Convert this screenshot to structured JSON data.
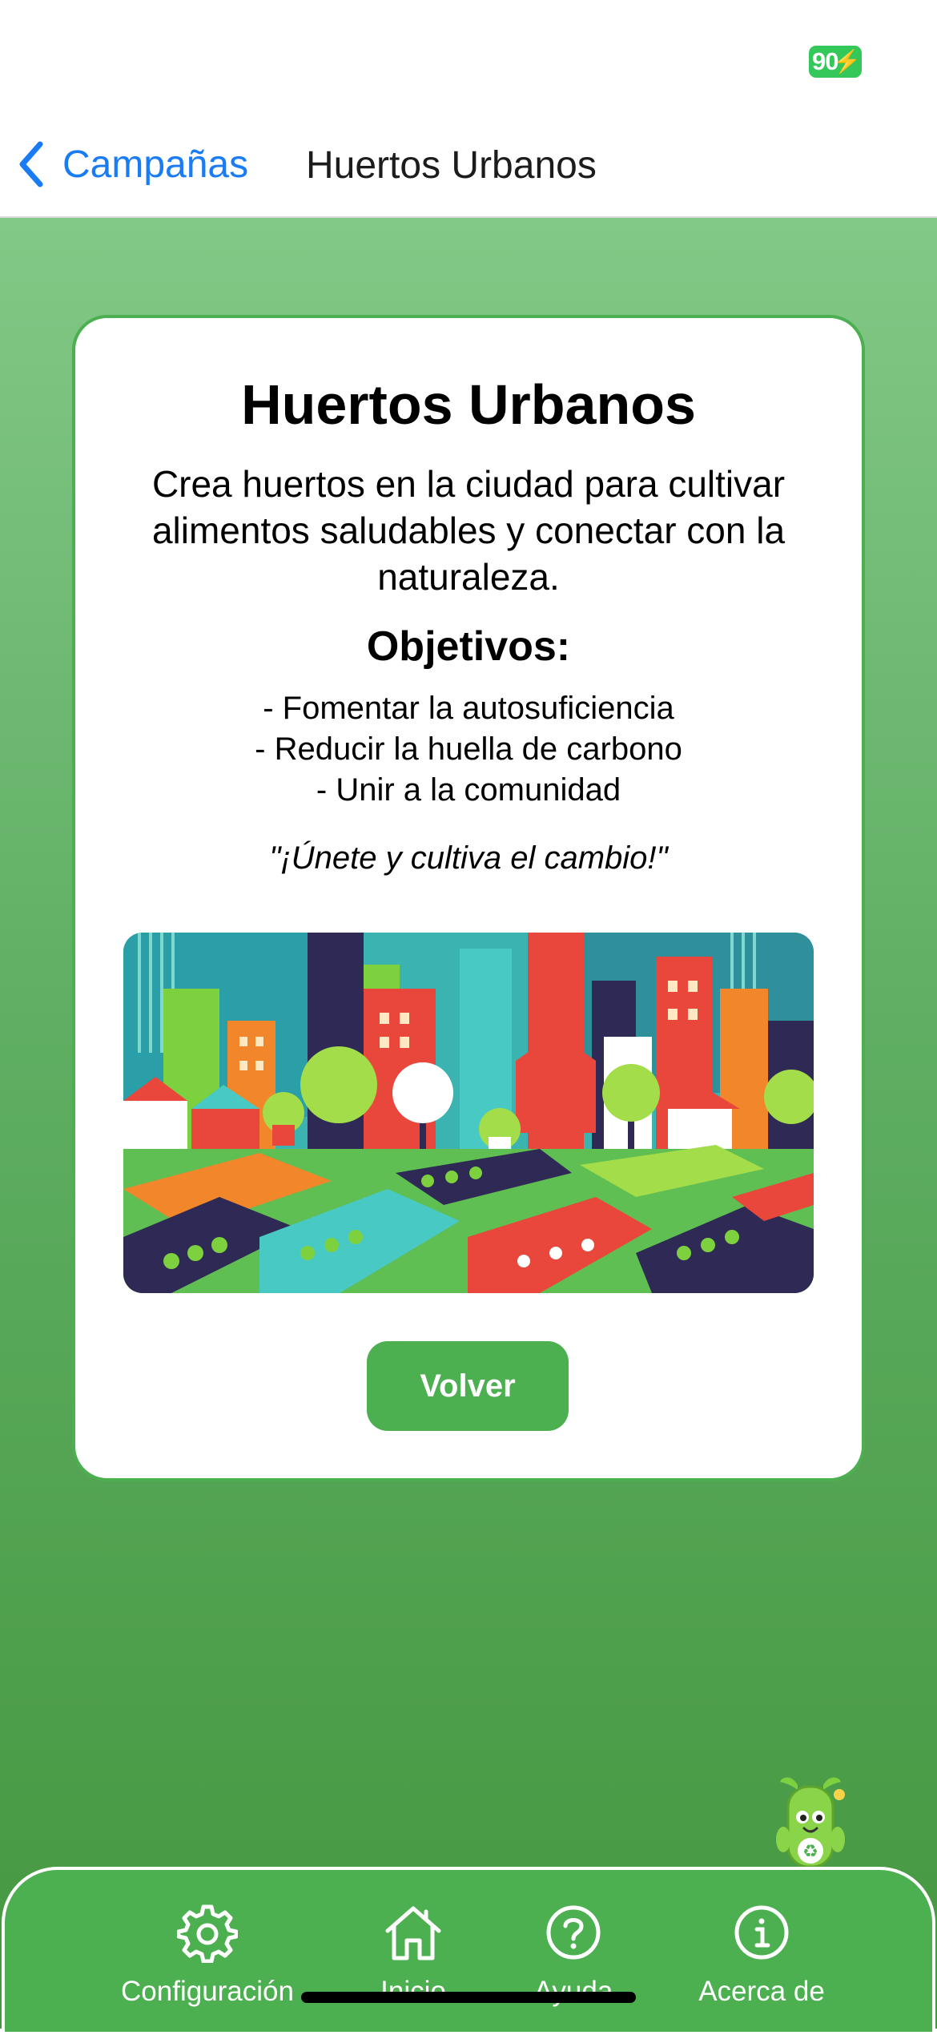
{
  "status_bar": {
    "battery_level": "90",
    "battery_color": "#34c759"
  },
  "nav": {
    "back_label": "Campañas",
    "title": "Huertos Urbanos",
    "back_icon": "chevron-left-icon",
    "accent_color": "#1a7cf5"
  },
  "card": {
    "title": "Huertos Urbanos",
    "description": "Crea huertos en la ciudad para cultivar alimentos saludables y conectar con la naturaleza.",
    "objectives_title": "Objetivos:",
    "objectives": [
      "- Fomentar la autosuficiencia",
      "- Reducir la huella de carbono",
      "- Unir a la comunidad"
    ],
    "quote": "\"¡Únete y cultiva el cambio!\"",
    "illustration": "urban-garden-illustration",
    "button_label": "Volver"
  },
  "theme": {
    "primary_green": "#4caf50",
    "background_top": "#82c886",
    "background_bottom": "#45973f"
  },
  "mascot": "recycling-mascot-icon",
  "tab_bar": {
    "items": [
      {
        "label": "Configuración",
        "icon": "gear-icon"
      },
      {
        "label": "Inicio",
        "icon": "home-icon"
      },
      {
        "label": "Ayuda",
        "icon": "help-icon"
      },
      {
        "label": "Acerca de",
        "icon": "info-icon"
      }
    ]
  }
}
